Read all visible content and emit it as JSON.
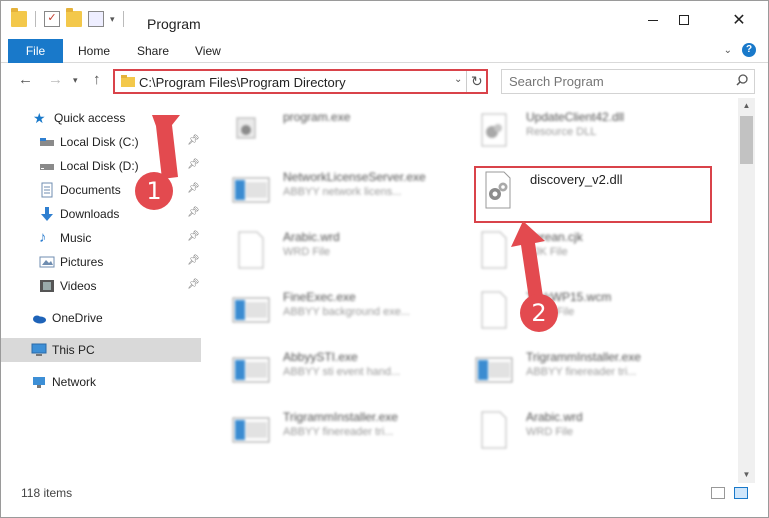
{
  "window": {
    "title": "Program",
    "controls": {
      "minimize": "minimize",
      "maximize": "maximize",
      "close": "✕"
    }
  },
  "ribbon": {
    "tabs": [
      "File",
      "Home",
      "Share",
      "View"
    ],
    "help": "?"
  },
  "address_bar": {
    "path": "C:\\Program Files\\Program Directory"
  },
  "search": {
    "placeholder": "Search Program"
  },
  "sidebar": {
    "items": [
      {
        "label": "Quick access",
        "icon": "star-icon",
        "pinned": false
      },
      {
        "label": "Local Disk (C:)",
        "icon": "drive-icon",
        "pinned": true
      },
      {
        "label": "Local Disk (D:)",
        "icon": "drive-icon",
        "pinned": true
      },
      {
        "label": "Documents",
        "icon": "documents-icon",
        "pinned": true
      },
      {
        "label": "Downloads",
        "icon": "downloads-icon",
        "pinned": true
      },
      {
        "label": "Music",
        "icon": "music-icon",
        "pinned": true
      },
      {
        "label": "Pictures",
        "icon": "pictures-icon",
        "pinned": true
      },
      {
        "label": "Videos",
        "icon": "videos-icon",
        "pinned": true
      },
      {
        "label": "OneDrive",
        "icon": "onedrive-icon",
        "pinned": false
      },
      {
        "label": "This PC",
        "icon": "computer-icon",
        "pinned": false,
        "selected": true
      },
      {
        "label": "Network",
        "icon": "network-icon",
        "pinned": false
      }
    ]
  },
  "files": [
    {
      "name": "program.exe",
      "desc": ""
    },
    {
      "name": "UpdateClient42.dll",
      "desc": "Resource DLL"
    },
    {
      "name": "NetworkLicenseServer.exe",
      "desc": "ABBYY network licens..."
    },
    {
      "name": "discovery_v2.dll",
      "desc": ""
    },
    {
      "name": "Arabic.wrd",
      "desc": "WRD File"
    },
    {
      "name": "Korean.cjk",
      "desc": "CJK File"
    },
    {
      "name": "FineExec.exe",
      "desc": "ABBYY background exe..."
    },
    {
      "name": "TaskWP15.wcm",
      "desc": "WCM File"
    },
    {
      "name": "AbbyySTI.exe",
      "desc": "ABBYY sti event hand..."
    },
    {
      "name": "TrigrammInstaller.exe",
      "desc": "ABBYY finereader tri..."
    },
    {
      "name": "TrigrammInstaller.exe",
      "desc": "ABBYY finereader tri..."
    },
    {
      "name": "Arabic.wrd",
      "desc": "WRD File"
    }
  ],
  "status": {
    "item_count": "118 items"
  },
  "callouts": [
    "1",
    "2"
  ],
  "colors": {
    "accent": "#1979ca",
    "highlight": "#d9434a",
    "callout": "#e34a4f"
  }
}
